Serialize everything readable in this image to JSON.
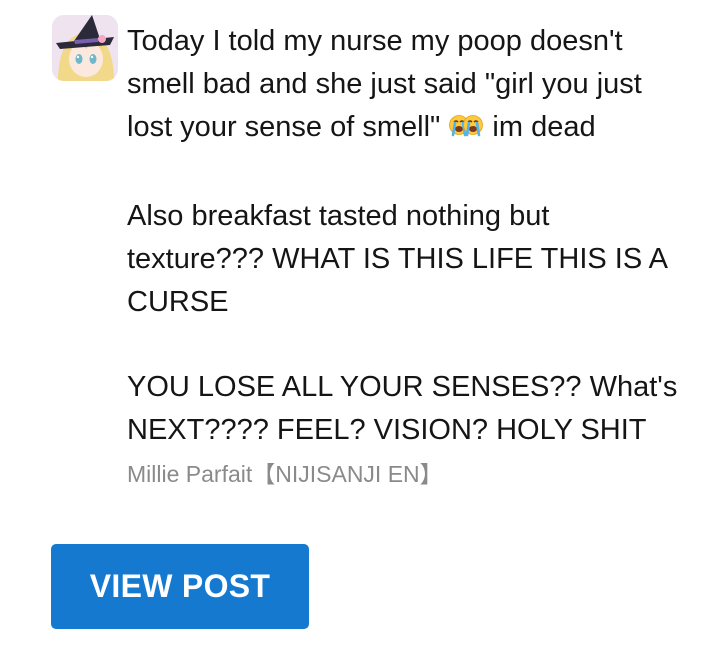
{
  "post": {
    "avatar_icon": "user-avatar-anime-witch",
    "line1_text": "Today I told my nurse my poop doesn't smell bad and she just said \"girl you just lost your sense of smell\"",
    "emoji_icon": "loudly-crying-face-emoji",
    "line1_suffix": " im dead",
    "paragraph2": "Also breakfast tasted nothing but texture??? WHAT IS THIS LIFE THIS IS A CURSE",
    "paragraph3": "YOU LOSE ALL YOUR SENSES?? What's NEXT???? FEEL? VISION? HOLY SHIT",
    "author": "Millie Parfait【NIJISANJI EN】"
  },
  "actions": {
    "view_post_label": "VIEW POST",
    "button_color": "#1579d0"
  }
}
